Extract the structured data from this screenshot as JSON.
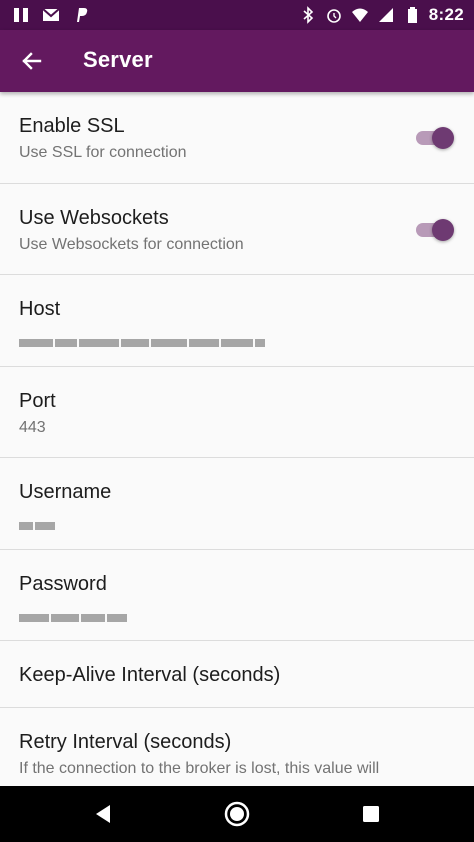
{
  "status_bar": {
    "time": "8:22",
    "left_icons": [
      "pause-icon",
      "gmail-icon",
      "paypal-icon"
    ],
    "right_icons": [
      "bluetooth-icon",
      "alarm-icon",
      "wifi-icon",
      "signal-icon",
      "battery-icon"
    ]
  },
  "app_bar": {
    "title": "Server",
    "back_icon": "arrow-back-icon",
    "color": "#63195f"
  },
  "settings": [
    {
      "title": "Enable SSL",
      "summary": "Use SSL for connection",
      "toggle": true
    },
    {
      "title": "Use Websockets",
      "summary": "Use Websockets for connection",
      "toggle": true
    },
    {
      "title": "Host",
      "summary": "",
      "redacted": true
    },
    {
      "title": "Port",
      "summary": "443"
    },
    {
      "title": "Username",
      "summary": "",
      "redacted": true
    },
    {
      "title": "Password",
      "summary": "",
      "redacted": true
    },
    {
      "title": "Keep-Alive Interval (seconds)",
      "summary": ""
    },
    {
      "title": "Retry Interval (seconds)",
      "summary": "If the connection to the broker is lost, this value will"
    }
  ],
  "nav_bar": {
    "buttons": [
      "back-triangle-icon",
      "home-circle-icon",
      "recents-square-icon"
    ]
  }
}
